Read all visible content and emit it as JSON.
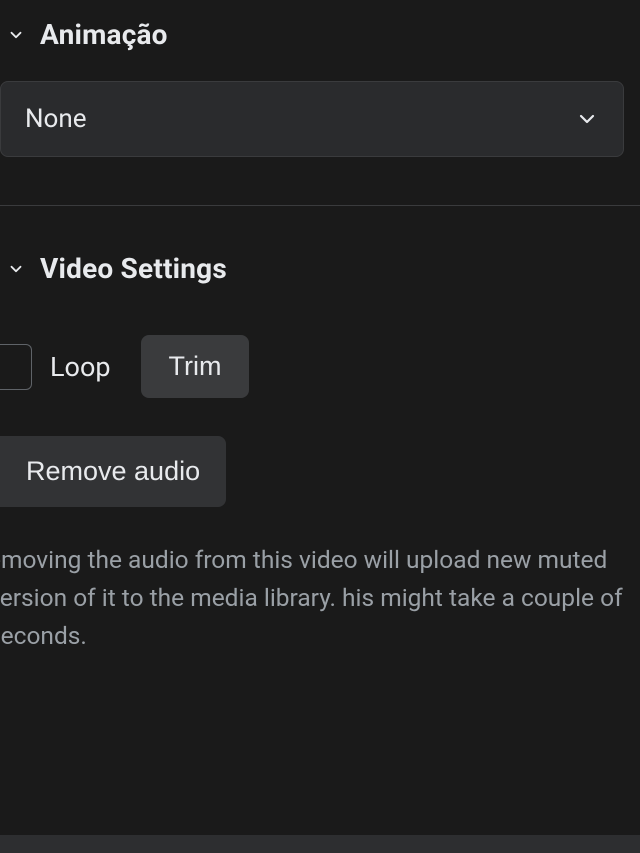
{
  "animation": {
    "title": "Animação",
    "selected": "None"
  },
  "video_settings": {
    "title": "Video Settings",
    "loop_label": "Loop",
    "trim_label": "Trim",
    "remove_audio_label": "Remove audio",
    "help_text": "emoving the audio from this video will upload  new muted version of it to the media library. his might take a couple of seconds."
  }
}
